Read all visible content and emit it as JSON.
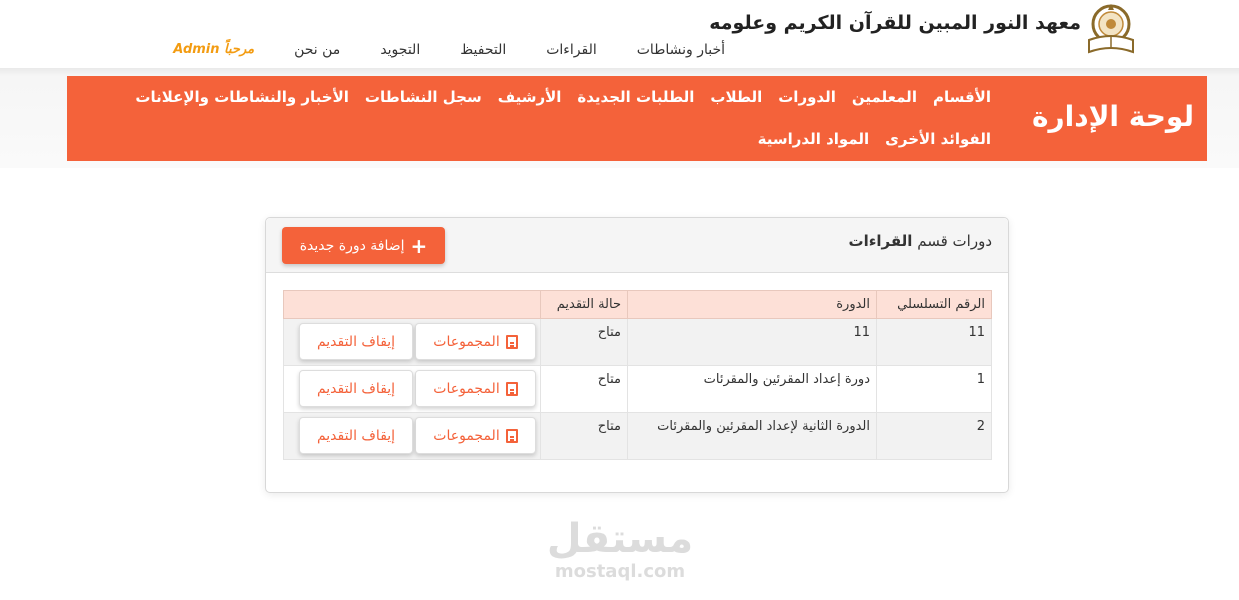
{
  "header": {
    "site_title": "معهد النور المبين للقرآن الكريم وعلومه",
    "nav": [
      "أخبار ونشاطات",
      "القراءات",
      "التحفيظ",
      "التجويد",
      "من نحن"
    ],
    "welcome": "مرحباً Admin"
  },
  "admin": {
    "title": "لوحة الإدارة",
    "menu": [
      "الأقسام",
      "المعلمين",
      "الدورات",
      "الطلاب",
      "الطلبات الجديدة",
      "الأرشيف",
      "سجل النشاطات",
      "الأخبار والنشاطات والإعلانات",
      "الفوائد الأخرى",
      "المواد الدراسية"
    ]
  },
  "card": {
    "title_prefix": "دورات قسم",
    "title_section": "القراءات",
    "add_button": "إضافة دورة جديدة",
    "columns": [
      "الرقم التسلسلي",
      "الدورة",
      "حالة التقديم",
      ""
    ],
    "rows": [
      {
        "serial": "11",
        "course": "11",
        "status": "متاح"
      },
      {
        "serial": "1",
        "course": "دورة إعداد المقرئين والمقرئات",
        "status": "متاح"
      },
      {
        "serial": "2",
        "course": "الدورة الثانية لإعداد المقرئين والمقرئات",
        "status": "متاح"
      }
    ],
    "groups_button": "المجموعات",
    "stop_button": "إيقاف التقديم"
  },
  "watermark": {
    "arabic": "مستقل",
    "latin": "mostaql.com"
  },
  "colors": {
    "accent": "#f4623a",
    "welcome": "#f39c12",
    "table_header": "#fde0d7"
  }
}
